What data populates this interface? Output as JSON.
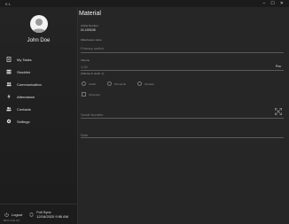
{
  "window": {
    "title": "K·L",
    "controls": [
      "–",
      "☐",
      "✕"
    ]
  },
  "user": {
    "name": "John Doe"
  },
  "nav": [
    {
      "label": "My Tasks",
      "icon": "clipboard-icon"
    },
    {
      "label": "Stocklist",
      "icon": "list-icon"
    },
    {
      "label": "Communication",
      "icon": "people-icon"
    },
    {
      "label": "Attendance",
      "icon": "bolt-icon"
    },
    {
      "label": "Contacts",
      "icon": "contacts-icon"
    },
    {
      "label": "Settings",
      "icon": "gear-icon"
    }
  ],
  "footer": {
    "logout_label": "Logout",
    "sync_title": "Full Sync",
    "sync_time": "12/16/2020 9:56 AM",
    "version": "BOX 2.00.0.0"
  },
  "main": {
    "title": "Material",
    "article_label": "Article Number",
    "article_value": "01.100108",
    "warehouse_label": "Warehouse name",
    "warehouse_placeholder": "Primary switch",
    "volume_label": "Volume",
    "volume_value": "1.00",
    "volume_unit": "Pcs",
    "volume_hint": "(Volume in stock: 1)",
    "radios": [
      "Install",
      "Dismantle",
      "Replace"
    ],
    "checkbox_label": "Scrapped",
    "serial_placeholder": "Serial Number",
    "note_placeholder": "Note"
  },
  "colors": {
    "background": "#262626",
    "sidebar": "#1f1f1f",
    "text": "#e6e6e6"
  }
}
